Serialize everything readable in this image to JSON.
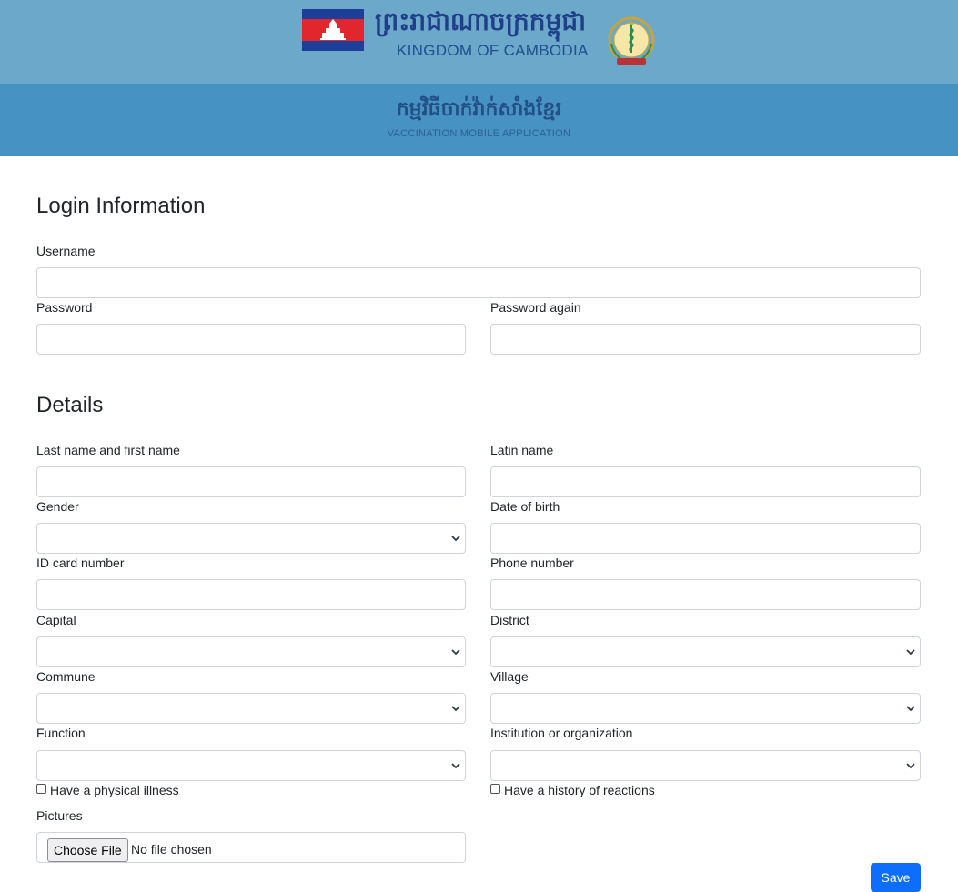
{
  "header": {
    "khmer_title": "ព្រះរាជាណាចក្រកម្ពុជា",
    "kingdom_subtitle": "KINGDOM OF CAMBODIA",
    "app_khmer_title": "កម្មវិធីចាក់វ៉ាក់សាំងខ្មែរ",
    "app_subtitle": "VACCINATION MOBILE APPLICATION",
    "flag_icon": "cambodia-flag-icon",
    "emblem_icon": "ministry-health-emblem-icon",
    "colors": {
      "top_band": "#6ba8c9",
      "bottom_band": "#4693c3",
      "title_text": "#1f3f8a"
    }
  },
  "login": {
    "section_title": "Login Information",
    "username_label": "Username",
    "username_value": "",
    "password_label": "Password",
    "password_value": "",
    "password_again_label": "Password again",
    "password_again_value": ""
  },
  "details": {
    "section_title": "Details",
    "last_first_name_label": "Last name and first name",
    "last_first_name_value": "",
    "latin_name_label": "Latin name",
    "latin_name_value": "",
    "gender_label": "Gender",
    "gender_selected": "",
    "dob_label": "Date of birth",
    "dob_value": "",
    "id_card_label": "ID card number",
    "id_card_value": "",
    "phone_label": "Phone number",
    "phone_value": "",
    "capital_label": "Capital",
    "capital_selected": "",
    "district_label": "District",
    "district_selected": "",
    "commune_label": "Commune",
    "commune_selected": "",
    "village_label": "Village",
    "village_selected": "",
    "function_label": "Function",
    "function_selected": "",
    "institution_label": "Institution or organization",
    "institution_selected": "",
    "physical_illness_label": "Have a physical illness",
    "physical_illness_checked": false,
    "reactions_history_label": "Have a history of reactions",
    "reactions_history_checked": false,
    "pictures_label": "Pictures",
    "choose_file_label": "Choose File",
    "no_file_text": "No file chosen"
  },
  "actions": {
    "save_label": "Save",
    "save_color": "#0d6efd"
  }
}
